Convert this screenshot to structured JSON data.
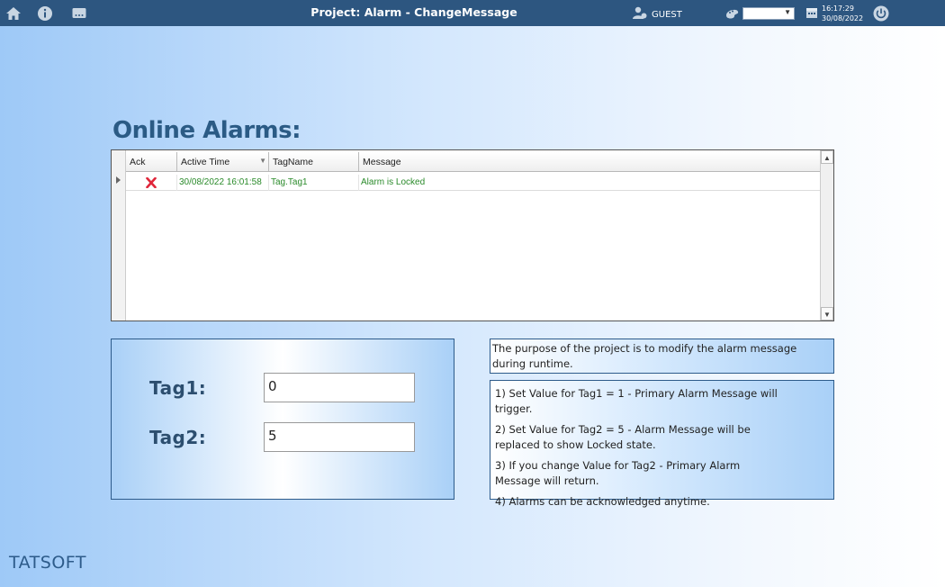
{
  "topbar": {
    "title": "Project: Alarm - ChangeMessage",
    "user": "GUEST",
    "language_value": "",
    "time": "16:17:29",
    "date": "30/08/2022",
    "icons": [
      "home-icon",
      "info-icon",
      "more-icon",
      "user-icon",
      "palette-icon",
      "calendar-icon",
      "power-icon"
    ]
  },
  "page": {
    "title": "Online Alarms:"
  },
  "grid": {
    "columns": [
      "Ack",
      "Active Time",
      "TagName",
      "Message"
    ],
    "rows": [
      {
        "ack": "X",
        "active_time": "30/08/2022 16:01:58",
        "tag_name": "Tag.Tag1",
        "message": "Alarm is Locked"
      }
    ],
    "row_text_color": "#2a8a2a",
    "ack_color": "#e0263a"
  },
  "tags": {
    "tag1_label": "Tag1:",
    "tag1_value": "0",
    "tag2_label": "Tag2:",
    "tag2_value": "5"
  },
  "info": {
    "purpose": "The purpose of the project is to modify the alarm message during runtime.",
    "steps": [
      "1) Set Value for Tag1 = 1 - Primary Alarm Message will trigger.",
      "2) Set Value for Tag2 = 5 - Alarm Message will be replaced to show Locked state.",
      "3) If you change Value for Tag2 - Primary Alarm Message will return.",
      "4) Alarms can be acknowledged anytime."
    ]
  },
  "logo": "TATSOFT",
  "colors": {
    "topbar": "#2d5680",
    "title": "#2b5b85",
    "panel_border": "#2d5b8a"
  }
}
